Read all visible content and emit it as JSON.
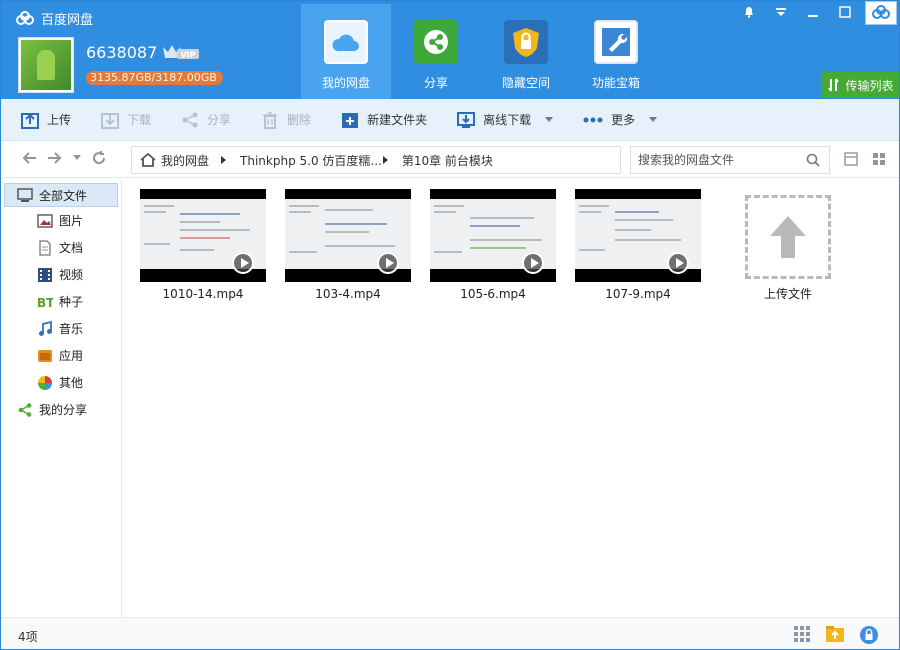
{
  "app": {
    "title": "百度网盘"
  },
  "user": {
    "name": "6638087",
    "vip": "VIP",
    "quota": "3135.87GB/3187.00GB"
  },
  "nav": [
    {
      "label": "我的网盘",
      "icon": "cloud-icon",
      "active": true
    },
    {
      "label": "分享",
      "icon": "share-icon"
    },
    {
      "label": "隐藏空间",
      "icon": "lock-icon"
    },
    {
      "label": "功能宝箱",
      "icon": "wrench-icon"
    }
  ],
  "transfer": {
    "label": "传输列表"
  },
  "toolbar": {
    "upload": "上传",
    "download": "下载",
    "share": "分享",
    "delete": "删除",
    "new_folder": "新建文件夹",
    "offline": "离线下载",
    "more": "更多"
  },
  "breadcrumb": [
    "我的网盘",
    "Thinkphp 5.0 仿百度糯...",
    "第10章 前台模块"
  ],
  "search": {
    "placeholder": "搜索我的网盘文件"
  },
  "sidebar": [
    {
      "label": "全部文件",
      "icon": "monitor-icon"
    },
    {
      "label": "图片",
      "icon": "image-icon"
    },
    {
      "label": "文档",
      "icon": "document-icon"
    },
    {
      "label": "视频",
      "icon": "video-icon"
    },
    {
      "label": "种子",
      "icon": "bt-icon"
    },
    {
      "label": "音乐",
      "icon": "music-icon"
    },
    {
      "label": "应用",
      "icon": "app-icon"
    },
    {
      "label": "其他",
      "icon": "other-icon"
    },
    {
      "label": "我的分享",
      "icon": "share-icon"
    }
  ],
  "files": [
    {
      "name": "1010-14.mp4"
    },
    {
      "name": "103-4.mp4"
    },
    {
      "name": "105-6.mp4"
    },
    {
      "name": "107-9.mp4"
    }
  ],
  "upload_tile": {
    "label": "上传文件"
  },
  "status": {
    "count": "4项"
  },
  "colors": {
    "header": "#2f8ee0",
    "accent": "#46a936",
    "quota": "#e17b3c"
  }
}
